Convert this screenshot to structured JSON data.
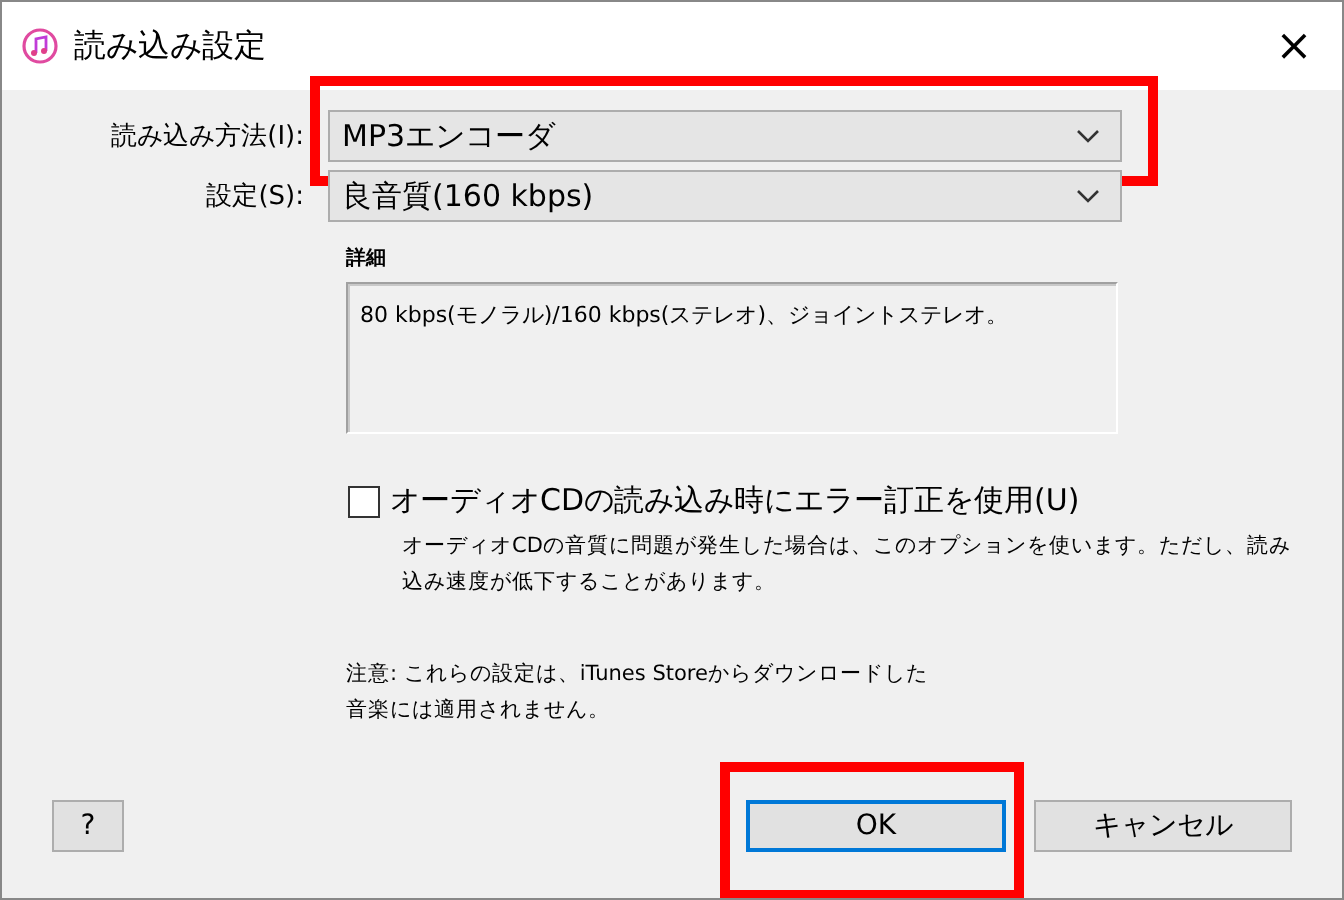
{
  "window": {
    "title": "読み込み設定",
    "close": "×"
  },
  "fields": [
    {
      "label": "読み込み方法(I):",
      "value": "MP3エンコーダ",
      "highlighted": true
    },
    {
      "label": "設定(S):",
      "value": "良音質(160 kbps)"
    }
  ],
  "details": {
    "label": "詳細",
    "text": "80 kbps(モノラル)/160 kbps(ステレオ)、ジョイントステレオ。"
  },
  "error_correction": {
    "label": "オーディオCDの読み込み時にエラー訂正を使用(U)",
    "checked": false,
    "description": "オーディオCDの音質に問題が発生した場合は、このオプションを使います。ただし、読み込み速度が低下することがあります。"
  },
  "note": "注意: これらの設定は、iTunes Storeからダウンロードした音楽には適用されません。",
  "buttons": [
    {
      "kind": "help",
      "label": "?"
    },
    {
      "kind": "ok",
      "label": "OK",
      "highlighted": true
    },
    {
      "kind": "cancel",
      "label": "キャンセル"
    }
  ]
}
